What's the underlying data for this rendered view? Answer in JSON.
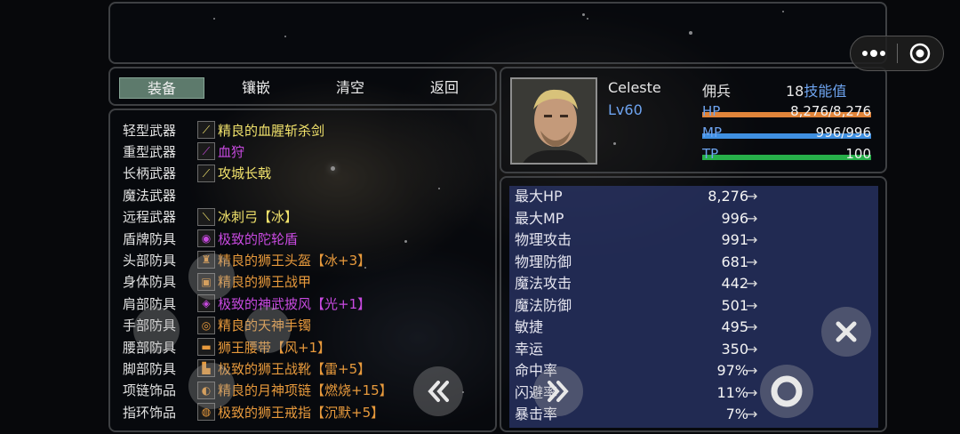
{
  "tabs": [
    {
      "label": "装备",
      "active": true
    },
    {
      "label": "镶嵌",
      "active": false
    },
    {
      "label": "清空",
      "active": false
    },
    {
      "label": "返回",
      "active": false
    }
  ],
  "equipment": [
    {
      "slot": "轻型武器",
      "item": "精良的血腥斩杀剑",
      "color": "#f2e36c",
      "icon": "sword-icon"
    },
    {
      "slot": "重型武器",
      "item": "血狩",
      "color": "#c84ae0",
      "icon": "greatsword-icon"
    },
    {
      "slot": "长柄武器",
      "item": "攻城长戟",
      "color": "#f2e36c",
      "icon": "halberd-icon"
    },
    {
      "slot": "魔法武器",
      "item": "",
      "color": "#f2e36c",
      "icon": ""
    },
    {
      "slot": "远程武器",
      "item": "冰刺弓【冰】",
      "color": "#f2e36c",
      "icon": "bow-icon"
    },
    {
      "slot": "盾牌防具",
      "item": "极致的陀轮盾",
      "color": "#c84ae0",
      "icon": "shield-icon"
    },
    {
      "slot": "头部防具",
      "item": "精良的狮王头盔【冰+3】",
      "color": "#e89a3c",
      "icon": "helmet-icon"
    },
    {
      "slot": "身体防具",
      "item": "精良的狮王战甲",
      "color": "#e89a3c",
      "icon": "armor-icon"
    },
    {
      "slot": "肩部防具",
      "item": "极致的神武披风【光+1】",
      "color": "#c84ae0",
      "icon": "cape-icon"
    },
    {
      "slot": "手部防具",
      "item": "精良的天神手镯",
      "color": "#e89a3c",
      "icon": "bracelet-icon"
    },
    {
      "slot": "腰部防具",
      "item": "狮王腰带【风+1】",
      "color": "#e89a3c",
      "icon": "belt-icon"
    },
    {
      "slot": "脚部防具",
      "item": "极致的狮王战靴【雷+5】",
      "color": "#e89a3c",
      "icon": "boots-icon"
    },
    {
      "slot": "项链饰品",
      "item": "精良的月神项链【燃烧+15】",
      "color": "#e89a3c",
      "icon": "necklace-icon"
    },
    {
      "slot": "指环饰品",
      "item": "极致的狮王戒指【沉默+5】",
      "color": "#e89a3c",
      "icon": "ring-icon"
    }
  ],
  "character": {
    "name": "Celeste",
    "level": "Lv60",
    "class": "佣兵",
    "skill_points_num": "18",
    "skill_points_label": "技能值",
    "hp": {
      "label": "HP",
      "value": "8,276/8,276",
      "fraction": 1.0,
      "color": "#e0843a"
    },
    "mp": {
      "label": "MP",
      "value": "996/996",
      "fraction": 1.0,
      "color": "#3f8fe0"
    },
    "tp": {
      "label": "TP",
      "value": "100",
      "fraction": 1.0,
      "color": "#27b04a"
    }
  },
  "stats": [
    {
      "label": "最大HP",
      "value": "8,276",
      "arrow": "→"
    },
    {
      "label": "最大MP",
      "value": "996",
      "arrow": "→"
    },
    {
      "label": "物理攻击",
      "value": "991",
      "arrow": "→"
    },
    {
      "label": "物理防御",
      "value": "681",
      "arrow": "→"
    },
    {
      "label": "魔法攻击",
      "value": "442",
      "arrow": "→"
    },
    {
      "label": "魔法防御",
      "value": "501",
      "arrow": "→"
    },
    {
      "label": "敏捷",
      "value": "495",
      "arrow": "→"
    },
    {
      "label": "幸运",
      "value": "350",
      "arrow": "→"
    },
    {
      "label": "命中率",
      "value": "97%",
      "arrow": "→"
    },
    {
      "label": "闪避率",
      "value": "11%",
      "arrow": "→"
    },
    {
      "label": "暴击率",
      "value": "7%",
      "arrow": "→"
    }
  ],
  "colors": {
    "accent_tab": "#5d7a6c",
    "stats_bg": "#2c386e",
    "level_text": "#6ea4f0",
    "skill_label": "#6ea4f0"
  }
}
